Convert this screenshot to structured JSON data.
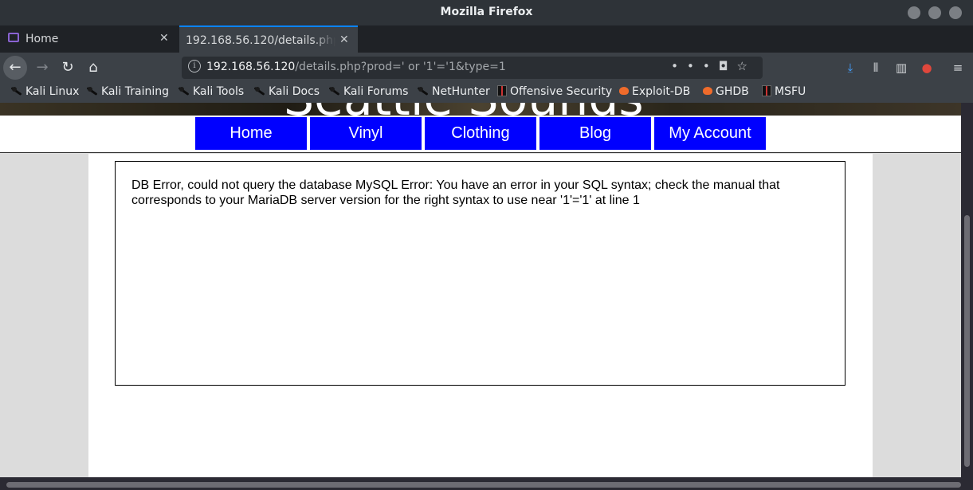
{
  "window": {
    "title": "Mozilla Firefox"
  },
  "tabs": [
    {
      "label": "Home",
      "active": false
    },
    {
      "label": "192.168.56.120/details.php?prod=' or '1'='1&type=1",
      "active": true
    }
  ],
  "urlbar": {
    "host": "192.168.56.120",
    "path": "/details.php?prod=' or '1'='1&type=1"
  },
  "bookmarks": [
    {
      "label": "Kali Linux",
      "icon": "kali-dragon-icon"
    },
    {
      "label": "Kali Training",
      "icon": "kali-dragon-icon"
    },
    {
      "label": "Kali Tools",
      "icon": "kali-dragon-icon"
    },
    {
      "label": "Kali Docs",
      "icon": "kali-dragon-icon"
    },
    {
      "label": "Kali Forums",
      "icon": "kali-dragon-icon"
    },
    {
      "label": "NetHunter",
      "icon": "kali-dragon-icon"
    },
    {
      "label": "Offensive Security",
      "icon": "offsec-icon"
    },
    {
      "label": "Exploit-DB",
      "icon": "exploitdb-icon"
    },
    {
      "label": "GHDB",
      "icon": "exploitdb-icon"
    },
    {
      "label": "MSFU",
      "icon": "offsec-icon"
    }
  ],
  "site": {
    "title": "Seattle Sounds",
    "menu": [
      "Home",
      "Vinyl",
      "Clothing",
      "Blog",
      "My Account"
    ],
    "menu_color": "#0000ff",
    "error_message": "DB Error, could not query the database MySQL Error: You have an error in your SQL syntax; check the manual that corresponds to your MariaDB server version for the right syntax to use near '1'='1' at line 1"
  }
}
